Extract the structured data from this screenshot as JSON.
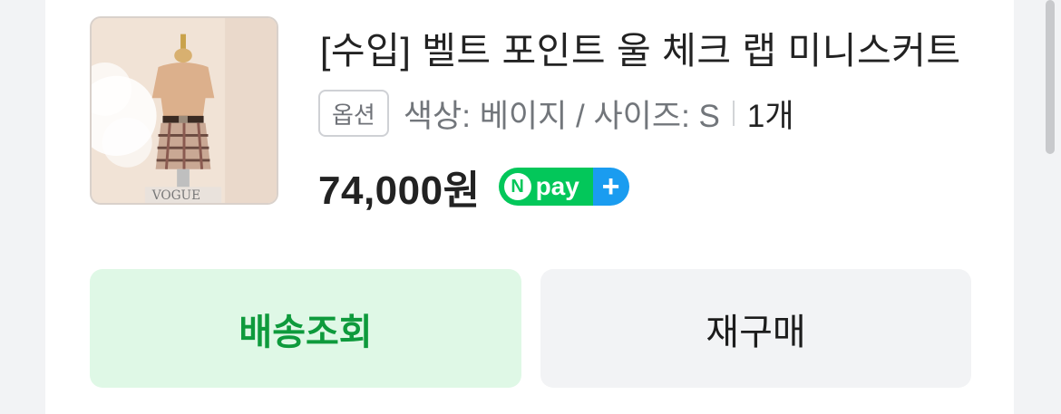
{
  "product": {
    "title": "[수입] 벨트 포인트 울 체크 랩 미니스커트",
    "image_alt": "product-photo"
  },
  "option": {
    "badge": "옵션",
    "text": "색상: 베이지 / 사이즈: S",
    "quantity": "1개"
  },
  "price": {
    "amount": "74,000원",
    "pay_badge": {
      "n": "N",
      "label": "pay",
      "plus": "+"
    }
  },
  "actions": {
    "track_label": "배송조회",
    "rebuy_label": "재구매"
  },
  "colors": {
    "npay_green": "#03c75a",
    "npay_blue": "#1a9cf0",
    "track_bg": "#dff8e6",
    "track_text": "#0e9a3c"
  }
}
